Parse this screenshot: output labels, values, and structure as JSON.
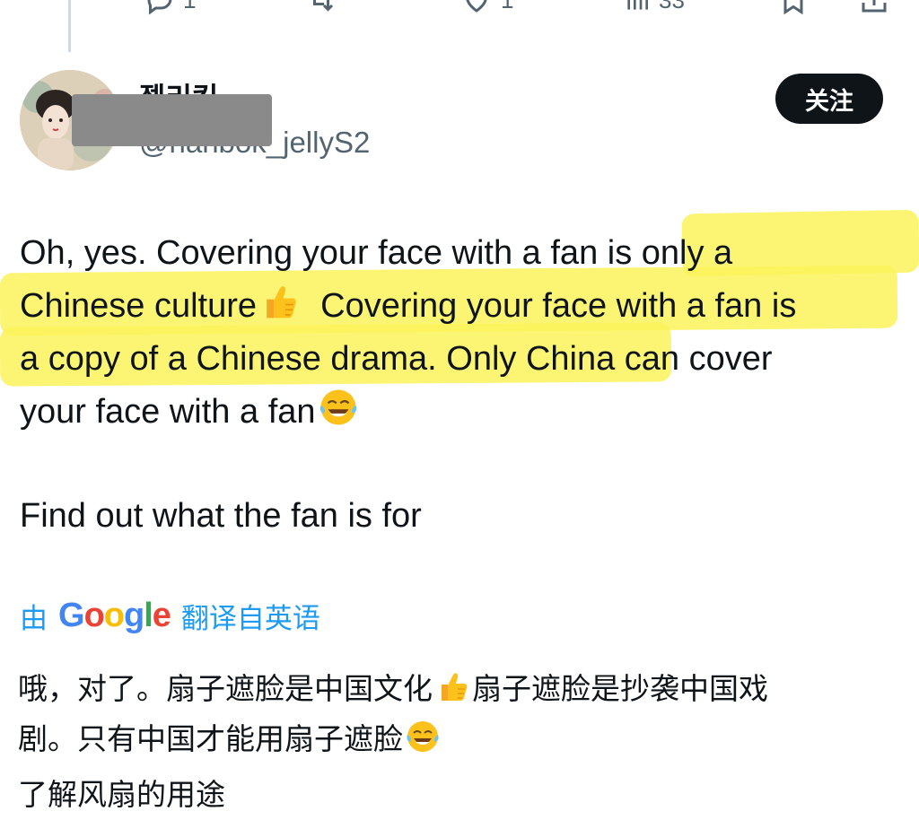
{
  "action_bar": {
    "reply_count": "1",
    "like_count": "1",
    "view_count": "33"
  },
  "author": {
    "display_name": "젤리킹",
    "handle": "@hanbok_jellyS2"
  },
  "follow_button": {
    "label": "关注"
  },
  "tweet": {
    "lines": [
      "Oh, yes. Covering your face with a fan is only a",
      "Chinese culture",
      "Covering your face with a fan is",
      "a copy of a Chinese drama. Only China can cover",
      "your face with a fan"
    ],
    "paragraph2": "Find out what the fan is for"
  },
  "translation": {
    "prefix": "由",
    "brand": "Google",
    "suffix": "翻译自英语",
    "lines": [
      "哦，对了。扇子遮脸是中国文化",
      "扇子遮脸是抄袭中国戏",
      "剧。只有中国才能用扇子遮脸"
    ],
    "paragraph2": "了解风扇的用途"
  },
  "colors": {
    "highlight": "#fbf35a",
    "link": "#1d9bf0",
    "button_bg": "#0f1419"
  }
}
